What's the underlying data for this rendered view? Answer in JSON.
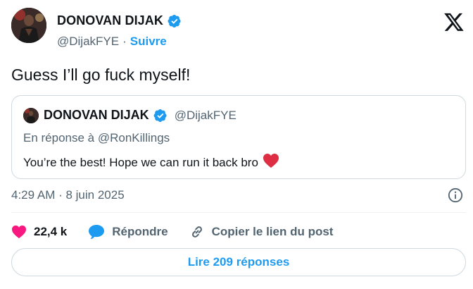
{
  "author": {
    "display_name": "DONOVAN DIJAK",
    "handle": "@DijakFYE",
    "separator": "·",
    "follow_label": "Suivre"
  },
  "tweet": {
    "text": "Guess I’ll go fuck myself!",
    "timestamp": "4:29 AM · 8 juin 2025"
  },
  "quote": {
    "display_name": "DONOVAN DIJAK",
    "handle": "@DijakFYE",
    "reply_to": "En réponse à @RonKillings",
    "text": "You’re the best! Hope we can run it back bro"
  },
  "actions": {
    "like_count": "22,4 k",
    "reply_label": "Répondre",
    "copy_link_label": "Copier le lien du post"
  },
  "read_replies_label": "Lire 209 réponses",
  "icons": {
    "verified": "verified-badge-icon",
    "x_logo": "x-logo-icon",
    "info": "info-icon",
    "like": "heart-icon",
    "reply": "speech-bubble-icon",
    "link": "link-icon",
    "red_heart": "red-heart-emoji"
  },
  "colors": {
    "accent": "#1d9bf0",
    "like": "#f91880",
    "text": "#0f1419",
    "secondary": "#536471",
    "border": "#cfd9de"
  }
}
